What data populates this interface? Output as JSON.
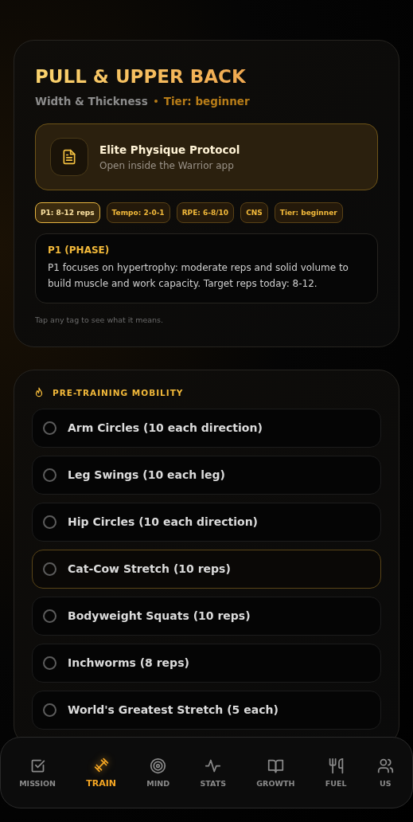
{
  "workout": {
    "title": "PULL & UPPER BACK",
    "subtitle": "Width & Thickness",
    "tier": "Tier: beginner"
  },
  "protocol": {
    "title": "Elite Physique Protocol",
    "subtitle": "Open inside the Warrior app"
  },
  "tags": [
    {
      "label": "P1: 8-12 reps",
      "selected": true
    },
    {
      "label": "Tempo: 2-0-1",
      "selected": false
    },
    {
      "label": "RPE: 6-8/10",
      "selected": false
    },
    {
      "label": "CNS",
      "selected": false
    },
    {
      "label": "Tier: beginner",
      "selected": false
    }
  ],
  "tag_info": {
    "title": "P1 (PHASE)",
    "text": "P1 focuses on hypertrophy: moderate reps and solid volume to build muscle and work capacity. Target reps today: 8-12."
  },
  "hint": "Tap any tag to see what it means.",
  "mobility": {
    "title": "PRE-TRAINING MOBILITY",
    "items": [
      {
        "label": "Arm Circles (10 each direction)",
        "checked": false,
        "highlighted": false
      },
      {
        "label": "Leg Swings (10 each leg)",
        "checked": false,
        "highlighted": false
      },
      {
        "label": "Hip Circles (10 each direction)",
        "checked": false,
        "highlighted": false
      },
      {
        "label": "Cat-Cow Stretch (10 reps)",
        "checked": false,
        "highlighted": true
      },
      {
        "label": "Bodyweight Squats (10 reps)",
        "checked": false,
        "highlighted": false
      },
      {
        "label": "Inchworms (8 reps)",
        "checked": false,
        "highlighted": false
      },
      {
        "label": "World's Greatest Stretch (5 each)",
        "checked": false,
        "highlighted": false
      }
    ]
  },
  "nav": [
    {
      "kind": "mission",
      "label": "MISSION",
      "selected": false
    },
    {
      "kind": "train",
      "label": "TRAIN",
      "selected": true
    },
    {
      "kind": "mind",
      "label": "MIND",
      "selected": false
    },
    {
      "kind": "stats",
      "label": "STATS",
      "selected": false
    },
    {
      "kind": "growth",
      "label": "GROWTH",
      "selected": false
    },
    {
      "kind": "fuel",
      "label": "FUEL",
      "selected": false
    },
    {
      "kind": "us",
      "label": "US",
      "selected": false
    }
  ]
}
